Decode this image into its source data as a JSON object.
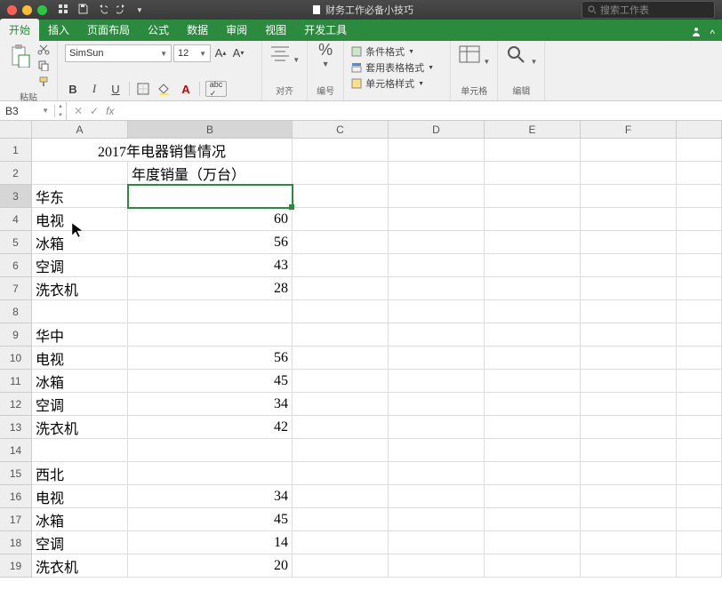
{
  "title": "财务工作必备小技巧",
  "search_placeholder": "搜索工作表",
  "tabs": [
    "开始",
    "插入",
    "页面布局",
    "公式",
    "数据",
    "审阅",
    "视图",
    "开发工具"
  ],
  "active_tab": 0,
  "paste_label": "粘贴",
  "font_name": "SimSun",
  "font_size": "12",
  "align_label": "对齐",
  "number_label": "编号",
  "cond_fmt": "条件格式",
  "table_fmt": "套用表格格式",
  "cell_style": "单元格样式",
  "cells_label": "单元格",
  "edit_label": "编辑",
  "namebox": "B3",
  "columns": [
    "A",
    "B",
    "C",
    "D",
    "E",
    "F",
    ""
  ],
  "rows": [
    {
      "n": "1",
      "a": "",
      "b": "2017年电器销售情况",
      "cls": "merge"
    },
    {
      "n": "2",
      "a": "",
      "b": "年度销量（万台）"
    },
    {
      "n": "3",
      "a": "华东",
      "b": ""
    },
    {
      "n": "4",
      "a": "电视",
      "b": "60"
    },
    {
      "n": "5",
      "a": "冰箱",
      "b": "56"
    },
    {
      "n": "6",
      "a": "空调",
      "b": "43"
    },
    {
      "n": "7",
      "a": "洗衣机",
      "b": "28"
    },
    {
      "n": "8",
      "a": "",
      "b": ""
    },
    {
      "n": "9",
      "a": "华中",
      "b": ""
    },
    {
      "n": "10",
      "a": "电视",
      "b": "56"
    },
    {
      "n": "11",
      "a": "冰箱",
      "b": "45"
    },
    {
      "n": "12",
      "a": "空调",
      "b": "34"
    },
    {
      "n": "13",
      "a": "洗衣机",
      "b": "42"
    },
    {
      "n": "14",
      "a": "",
      "b": ""
    },
    {
      "n": "15",
      "a": "西北",
      "b": ""
    },
    {
      "n": "16",
      "a": "电视",
      "b": "34"
    },
    {
      "n": "17",
      "a": "冰箱",
      "b": "45"
    },
    {
      "n": "18",
      "a": "空调",
      "b": "14"
    },
    {
      "n": "19",
      "a": "洗衣机",
      "b": "20"
    }
  ]
}
